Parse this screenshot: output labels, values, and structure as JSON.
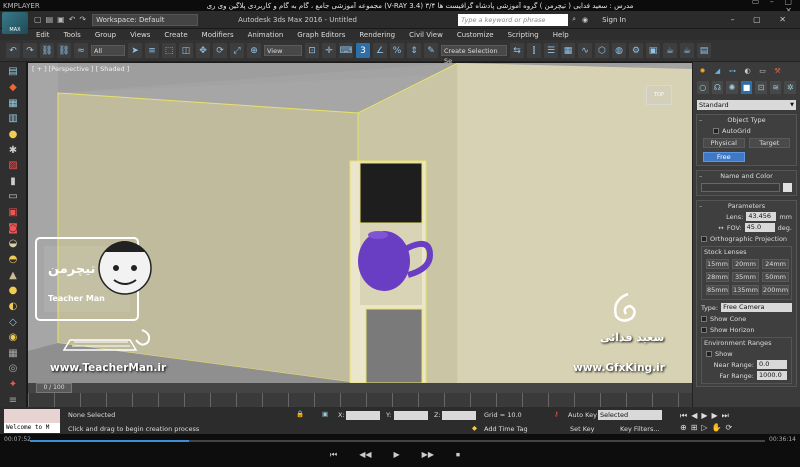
{
  "player": {
    "brand": "KMPLAYER",
    "video_title": "مجموعه آموزشی جامع ، گام به گام و کاربردی پلاگین وی ری (V-RAY 3.4) ۳/۴ مدرس : سعید فدایی ( تیچرمن ) گروه آموزشی پادشاه گرافیست ها",
    "window_ctrls": "▭ – ▢ ✕",
    "time_elapsed": "00:07:52",
    "time_total": "00:36:14",
    "progress_fraction": 0.217,
    "controls": [
      "⏮",
      "◀◀",
      "▶",
      "▶▶",
      "⏹"
    ]
  },
  "app": {
    "logo": "MAX",
    "workspace": "Workspace: Default",
    "title": "Autodesk 3ds Max 2016 - Untitled",
    "search_placeholder": "Type a keyword or phrase",
    "sign_in": "Sign In"
  },
  "menu": [
    "Edit",
    "Tools",
    "Group",
    "Views",
    "Create",
    "Modifiers",
    "Animation",
    "Graph Editors",
    "Rendering",
    "Civil View",
    "Customize",
    "Scripting",
    "Help"
  ],
  "toolbar": {
    "filter": "All",
    "ref_coord": "View",
    "selection_set": "Create Selection Se"
  },
  "viewport": {
    "label": "[ + ] [Perspective ] [ Shaded ]",
    "nav_cube": "TOP"
  },
  "watermarks": {
    "left_url": "www.TeacherMan.ir",
    "left_brand": "Teacher Man",
    "left_persian": "تیچرمن",
    "right_url": "www.GfxKing.ir",
    "right_name": "سعید فدائی"
  },
  "command_panel": {
    "category": "Standard",
    "object_type": {
      "title": "Object Type",
      "autogrid": "AutoGrid",
      "buttons": [
        "Physical",
        "Target",
        "Free"
      ]
    },
    "name_color": {
      "title": "Name and Color"
    },
    "parameters": {
      "title": "Parameters",
      "lens_label": "Lens:",
      "lens_value": "43.456",
      "lens_unit": "mm",
      "fov_label": "FOV:",
      "fov_value": "45.0",
      "fov_unit": "deg.",
      "ortho": "Orthographic Projection",
      "stock_title": "Stock Lenses",
      "stock_lenses": [
        "15mm",
        "20mm",
        "24mm",
        "28mm",
        "35mm",
        "50mm",
        "85mm",
        "135mm",
        "200mm"
      ],
      "type_label": "Type:",
      "type_value": "Free Camera",
      "show_cone": "Show Cone",
      "show_horizon": "Show Horizon",
      "env_title": "Environment Ranges",
      "env_show": "Show",
      "near_label": "Near Range:",
      "near_value": "0.0",
      "far_label": "Far Range:",
      "far_value": "1000.0"
    }
  },
  "timeline": {
    "frame": "0 / 100"
  },
  "status": {
    "maxscript": "Welcome to M",
    "none_selected": "None Selected",
    "prompt": "Click and drag to begin creation process",
    "x_label": "X:",
    "y_label": "Y:",
    "z_label": "Z:",
    "grid": "Grid = 10.0",
    "add_time_tag": "Add Time Tag",
    "auto_key": "Auto Key",
    "set_key": "Set Key",
    "selected": "Selected",
    "key_filters": "Key Filters..."
  }
}
